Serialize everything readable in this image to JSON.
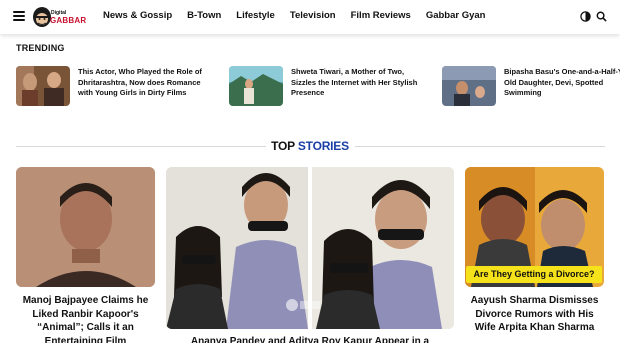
{
  "header": {
    "logo": {
      "line1": "Digital",
      "line2": "GABBAR"
    },
    "nav": [
      {
        "label": "News & Gossip"
      },
      {
        "label": "B-Town"
      },
      {
        "label": "Lifestyle"
      },
      {
        "label": "Television"
      },
      {
        "label": "Film Reviews"
      },
      {
        "label": "Gabbar Gyan"
      }
    ],
    "icons": [
      "menu-icon",
      "dark-mode-icon",
      "search-icon"
    ]
  },
  "trending": {
    "title": "TRENDING",
    "items": [
      {
        "text": "This Actor, Who Played the Role of Dhritarashtra, Now does Romance with Young Girls in Dirty Films"
      },
      {
        "text": "Shweta Tiwari, a Mother of Two, Sizzles the Internet with Her Stylish Presence"
      },
      {
        "text": "Bipasha Basu's One-and-a-Half-Year-Old Daughter, Devi, Spotted Swimming"
      }
    ]
  },
  "top_stories": {
    "title_part1": "TOP",
    "title_part2": "STORIES",
    "cards": [
      {
        "title": "Manoj Bajpayee Claims he Liked Ranbir Kapoor's “Animal”; Calls it an Entertaining Film"
      },
      {
        "title": "Ananya Pandey and Aditya Roy Kapur Appear in a"
      },
      {
        "title": "Aayush Sharma Dismisses Divorce Rumors with His Wife Arpita Khan Sharma",
        "banner": "Are They Getting a Divorce?"
      }
    ]
  },
  "colors": {
    "accent": "#1a3fa6",
    "brand": "#c8102e",
    "banner": "#f5e21a"
  }
}
